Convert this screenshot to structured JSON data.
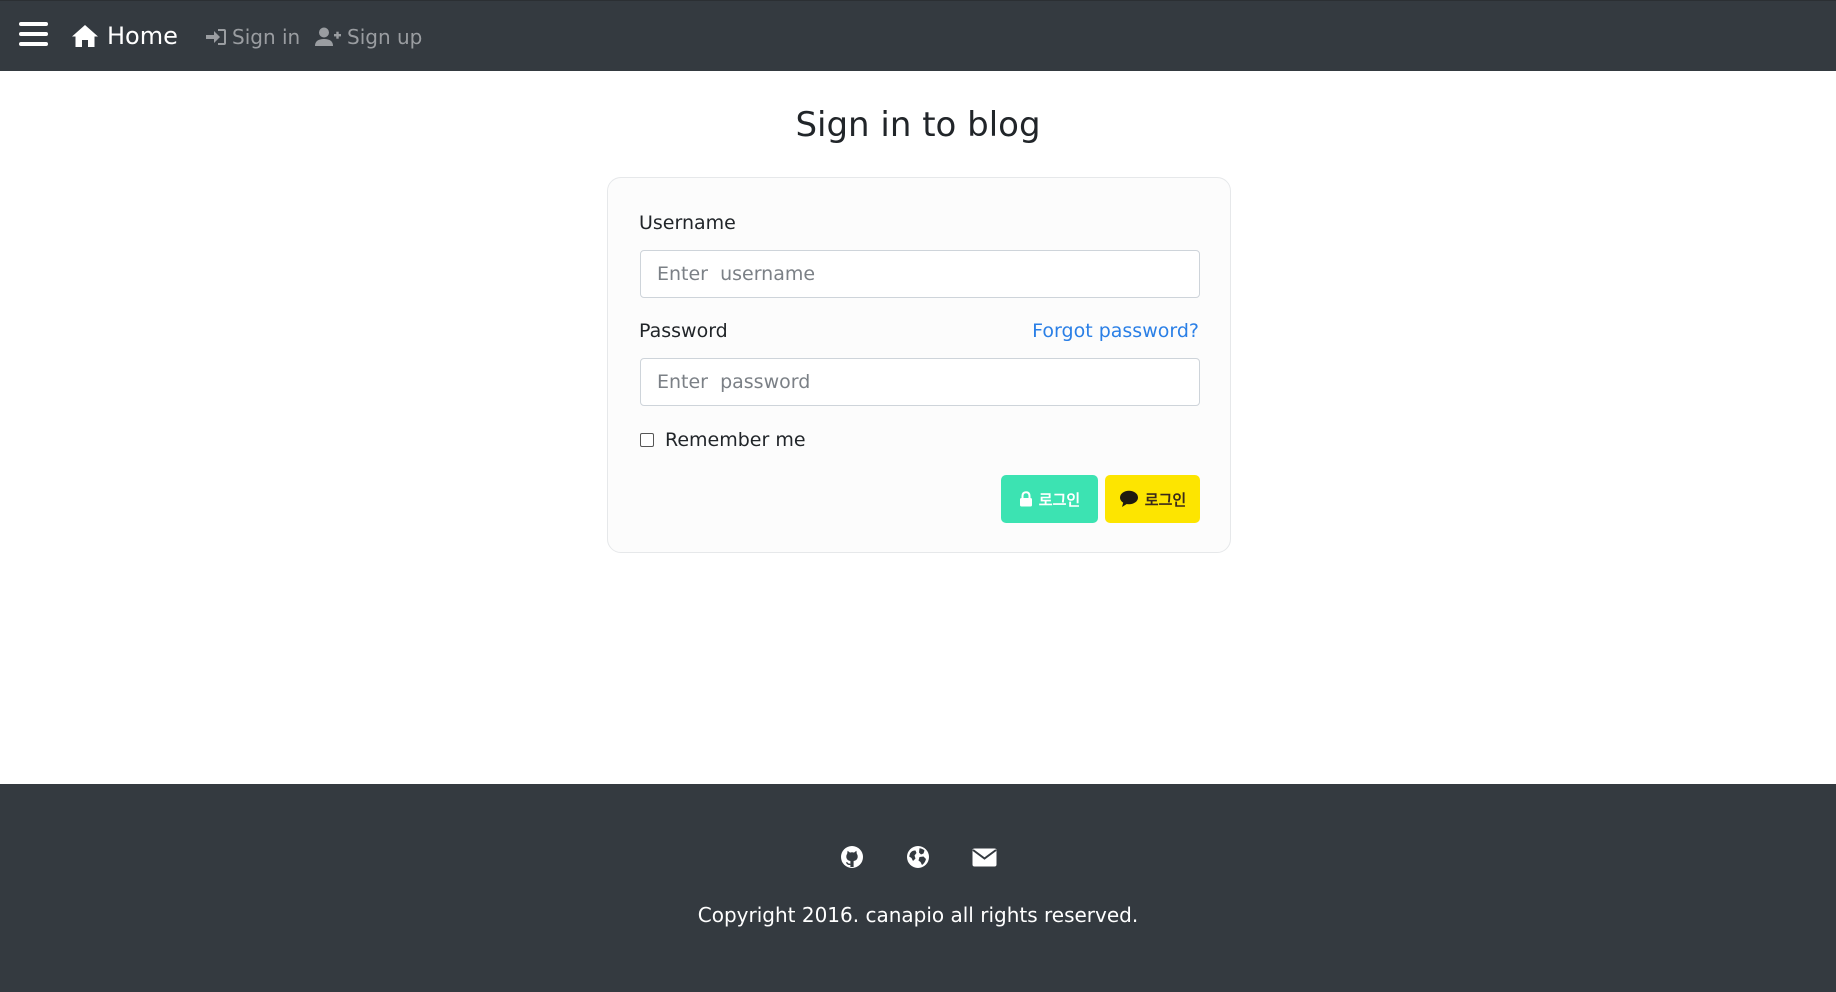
{
  "nav": {
    "home_label": "Home",
    "signin_label": "Sign in",
    "signup_label": "Sign up",
    "icons": {
      "menu": "hamburger-menu-icon",
      "home": "home-icon",
      "signin": "sign-in-icon",
      "signup": "user-plus-icon"
    }
  },
  "main": {
    "title": "Sign in to blog"
  },
  "form": {
    "username_label": "Username",
    "username_placeholder": "Enter  username",
    "username_value": "",
    "password_label": "Password",
    "password_placeholder": "Enter  password",
    "password_value": "",
    "forgot_label": "Forgot password?",
    "remember_label": "Remember me",
    "remember_checked": false,
    "login_button_label": "로그인",
    "kakao_button_label": "로그인"
  },
  "footer": {
    "copyright": "Copyright 2016. canapio all rights reserved.",
    "icons": [
      "github-icon",
      "globe-icon",
      "envelope-icon"
    ]
  },
  "colors": {
    "navbar_bg": "#343a40",
    "footer_bg": "#343a40",
    "link_blue": "#2a7fe6",
    "login_button": "#3ce3b2",
    "kakao_button": "#fde500"
  }
}
